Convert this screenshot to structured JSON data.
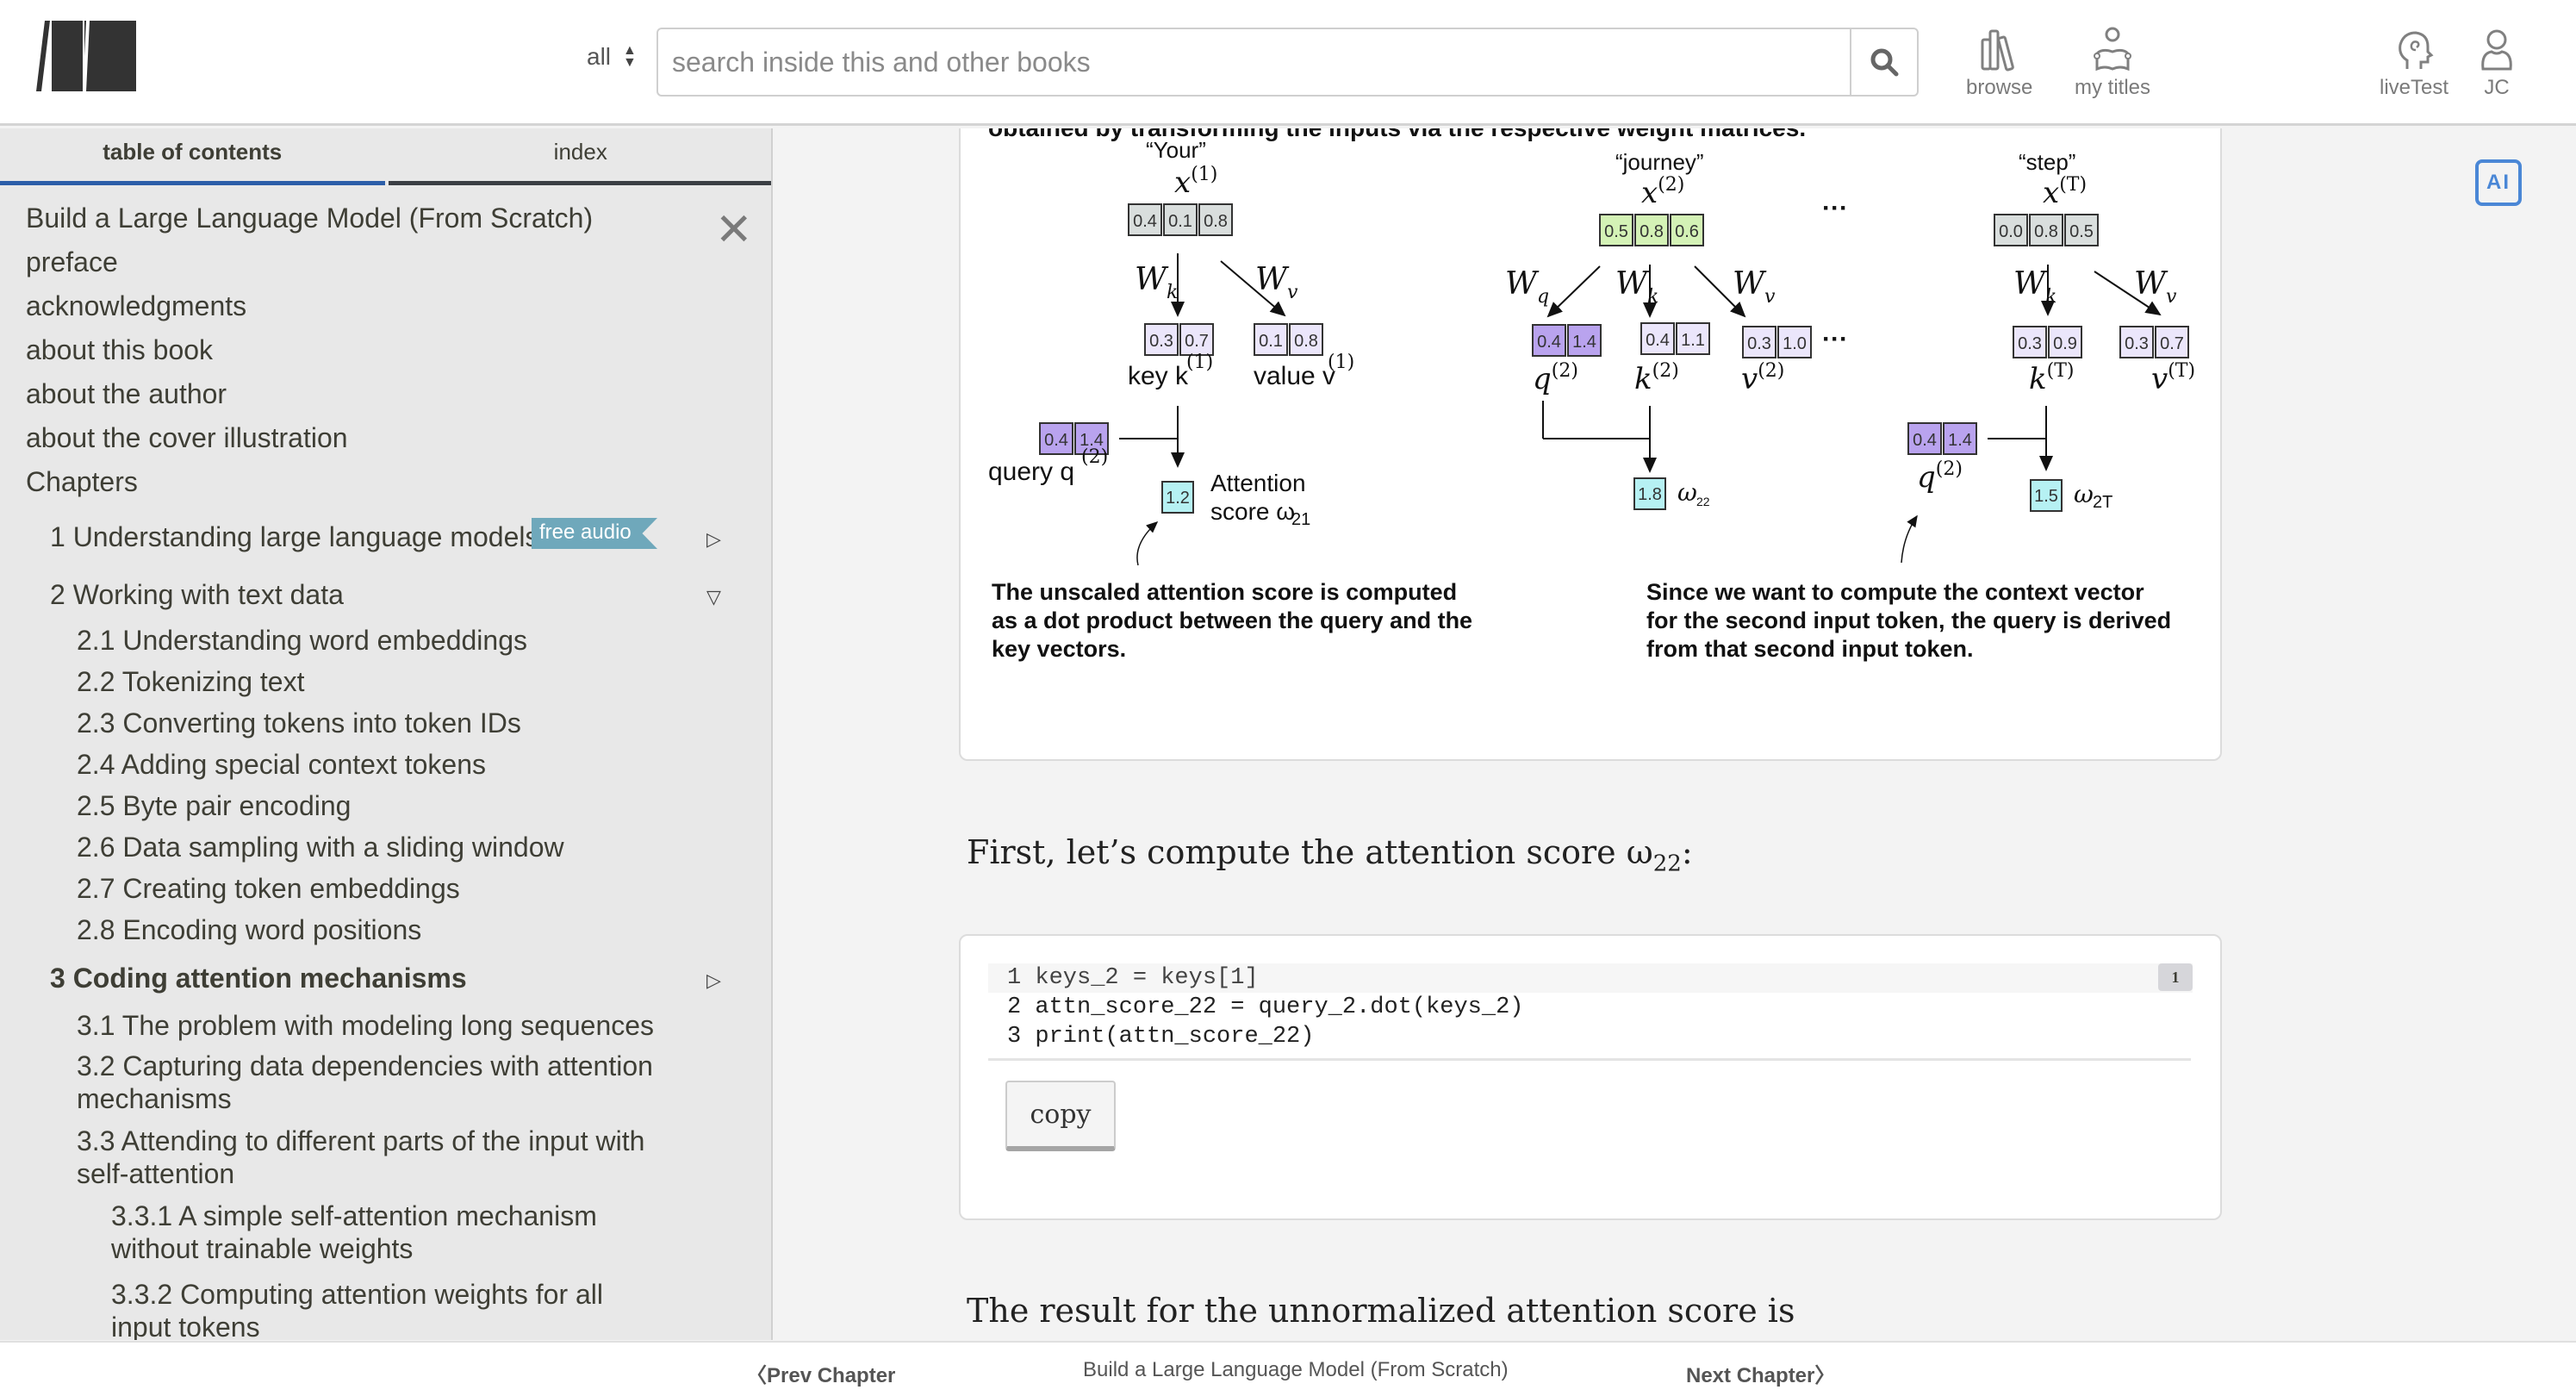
{
  "header": {
    "scope_select": "all",
    "search_placeholder": "search inside this and other books",
    "nav": [
      {
        "label": "browse",
        "icon": "books-icon"
      },
      {
        "label": "my titles",
        "icon": "reader-icon"
      },
      {
        "label": "liveTest",
        "icon": "head-icon"
      },
      {
        "label": "JC",
        "icon": "user-icon"
      }
    ]
  },
  "sidebar": {
    "tabs": [
      {
        "label": "table of contents",
        "active": true
      },
      {
        "label": "index",
        "active": false
      }
    ],
    "book_title": "Build a Large Language Model (From Scratch)",
    "front_matter": [
      "preface",
      "acknowledgments",
      "about this book",
      "about the author",
      "about the cover illustration"
    ],
    "chapters_label": "Chapters",
    "chapters": [
      {
        "label": "1 Understanding large language models",
        "badge": "free audio",
        "state": "collapsed"
      },
      {
        "label": "2 Working with text data",
        "state": "expanded",
        "sections": [
          "2.1 Understanding word embeddings",
          "2.2 Tokenizing text",
          "2.3 Converting tokens into token IDs",
          "2.4 Adding special context tokens",
          "2.5 Byte pair encoding",
          "2.6 Data sampling with a sliding window",
          "2.7 Creating token embeddings",
          "2.8 Encoding word positions"
        ]
      },
      {
        "label": "3 Coding attention mechanisms",
        "state": "collapsed",
        "current": true,
        "sections": [
          "3.1 The problem with modeling long sequences",
          "3.2 Capturing data dependencies with attention mechanisms",
          "3.3 Attending to different parts of the input with self-attention"
        ],
        "subsections": [
          "3.3.1 A simple self-attention mechanism without trainable weights",
          "3.3.2 Computing attention weights for all input tokens"
        ]
      }
    ]
  },
  "figure": {
    "caption_top": "obtained by transforming the inputs via the respective weight matrices.",
    "tokens": [
      {
        "word": "“Your”",
        "x_label": "x",
        "x_sup": "(1)",
        "x": [
          "0.4",
          "0.1",
          "0.8"
        ],
        "key": [
          "0.3",
          "0.7"
        ],
        "value": [
          "0.1",
          "0.8"
        ],
        "key_label": "key k",
        "key_sup": "(1)",
        "value_label": "value v",
        "value_sup": "(1)",
        "query": [
          "0.4",
          "1.4"
        ],
        "query_label": "query q",
        "query_sup": "(2)",
        "score": "1.2",
        "score_label": "Attention score ω",
        "score_sub": "21"
      },
      {
        "word": "“journey”",
        "x_label": "x",
        "x_sup": "(2)",
        "x": [
          "0.5",
          "0.8",
          "0.6"
        ],
        "query": [
          "0.4",
          "1.4"
        ],
        "key": [
          "0.4",
          "1.1"
        ],
        "value": [
          "0.3",
          "1.0"
        ],
        "query_label": "q",
        "query_sup": "(2)",
        "key_label": "k",
        "key_sup": "(2)",
        "value_label": "v",
        "value_sup": "(2)",
        "score": "1.8",
        "score_label": "ω",
        "score_sub": "22"
      },
      {
        "word": "“step”",
        "x_label": "x",
        "x_sup": "(T)",
        "x": [
          "0.0",
          "0.8",
          "0.5"
        ],
        "key": [
          "0.3",
          "0.9"
        ],
        "value": [
          "0.3",
          "0.7"
        ],
        "key_label": "k",
        "key_sup": "(T)",
        "value_label": "v",
        "value_sup": "(T)",
        "query": [
          "0.4",
          "1.4"
        ],
        "query_label": "q",
        "query_sup": "(2)",
        "score": "1.5",
        "score_label": "ω",
        "score_sub": "2T"
      }
    ],
    "weights": {
      "q": "W",
      "q_sub": "q",
      "k": "W",
      "k_sub": "k",
      "v": "W",
      "v_sub": "v"
    },
    "ellipsis": "···",
    "note_left": "The unscaled attention score is computed as a dot product between the query and the key vectors.",
    "note_right": "Since we want to compute the context vector for the second input token, the query is derived from that second input token.",
    "colors": {
      "input_gray": "#d9dedd",
      "input_green": "#d4f2b6",
      "query_purple": "#b9a3ee",
      "kv_lavender": "#ebe6fb",
      "score_cyan": "#b6f1f3"
    }
  },
  "content": {
    "para1_text": "First, let’s compute the attention score ω",
    "para1_sub": "22",
    "para1_end": ":",
    "code_lines": [
      "1 keys_2 = keys[1]",
      "2 attn_score_22 = query_2.dot(keys_2)",
      "3 print(attn_score_22)"
    ],
    "code_badge": "1",
    "copy_label": "copy",
    "para2_text": "The result for the unnormalized attention score is",
    "ai_label": "AI"
  },
  "footer": {
    "prev": "Prev Chapter",
    "title": "Build a Large Language Model (From Scratch)",
    "next": "Next Chapter"
  }
}
